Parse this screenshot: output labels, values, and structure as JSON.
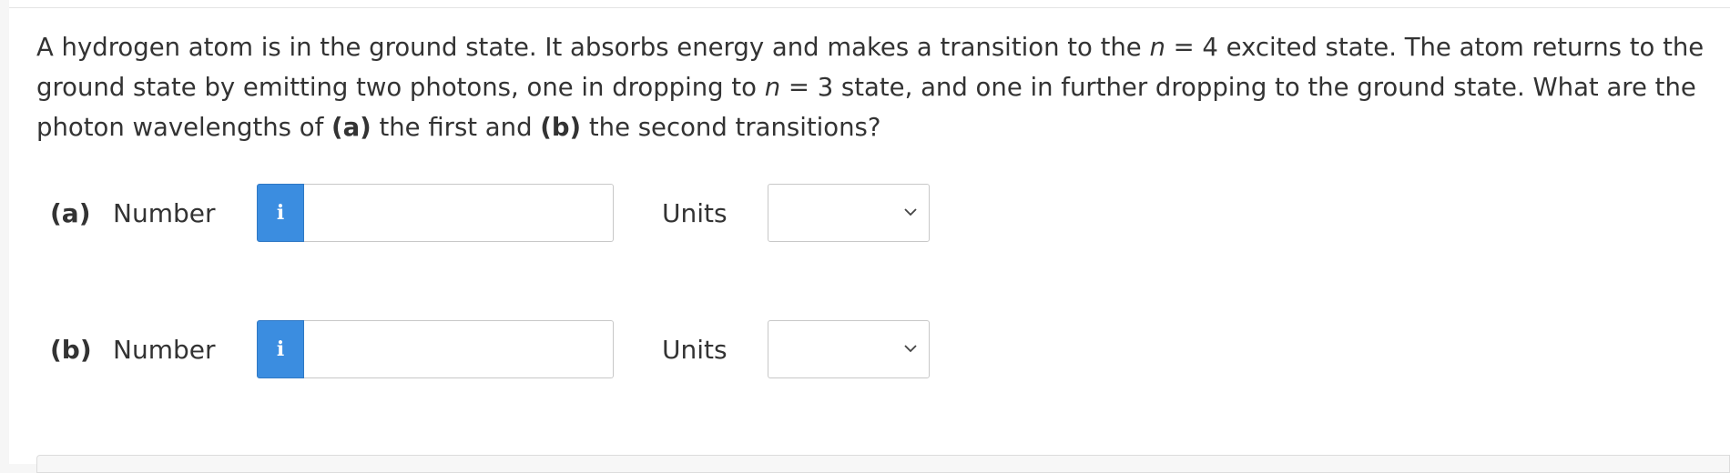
{
  "question": {
    "segments": [
      {
        "text": "A hydrogen atom is in the ground state. It absorbs energy and makes a transition to the ",
        "style": "normal"
      },
      {
        "text": "n",
        "style": "italic"
      },
      {
        "text": " = 4 excited state. The atom returns to the ground state by emitting two photons, one in dropping to ",
        "style": "normal"
      },
      {
        "text": "n",
        "style": "italic"
      },
      {
        "text": " = 3 state, and one in further dropping to the ground state. What are the photon wavelengths of ",
        "style": "normal"
      },
      {
        "text": "(a)",
        "style": "bold"
      },
      {
        "text": " the first and ",
        "style": "normal"
      },
      {
        "text": "(b)",
        "style": "bold"
      },
      {
        "text": " the second transitions?",
        "style": "normal"
      }
    ]
  },
  "parts": [
    {
      "label": "(a)",
      "number_label": "Number",
      "info_glyph": "i",
      "number_value": "",
      "units_label": "Units",
      "units_value": ""
    },
    {
      "label": "(b)",
      "number_label": "Number",
      "info_glyph": "i",
      "number_value": "",
      "units_label": "Units",
      "units_value": ""
    }
  ],
  "colors": {
    "info_button": "#3b8de0",
    "text": "#333333",
    "border": "#c8c8c8"
  }
}
